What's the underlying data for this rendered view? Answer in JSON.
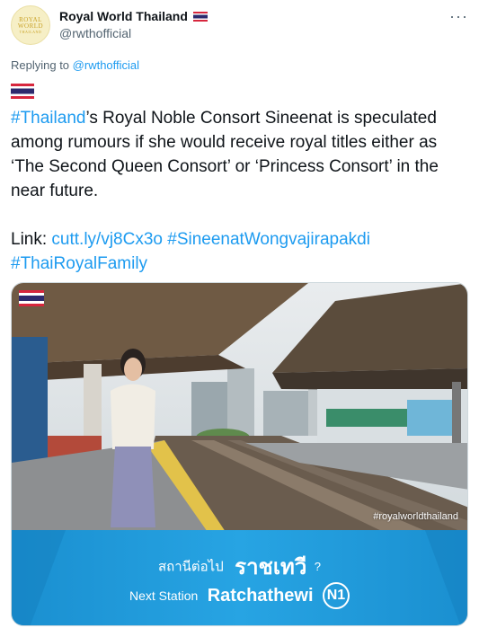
{
  "author": {
    "display_name": "Royal World Thailand",
    "handle": "@rwthofficial",
    "avatar_text": [
      "ROYAL",
      "WORLD",
      "THAILAND"
    ]
  },
  "more_icon": "···",
  "replying": {
    "prefix": "Replying to",
    "handle": "@rwthofficial"
  },
  "body": {
    "hashtag_thailand": "#Thailand",
    "sentence": "’s Royal Noble Consort Sineenat is speculated among rumours if she would receive royal titles either as ‘The Second Queen Consort’ or ‘Princess Consort’ in the near future.",
    "link_label": "Link:",
    "link": "cutt.ly/vj8Cx3o",
    "hashtag_sineenat": "#SineenatWongvajirapakdi",
    "hashtag_family": "#ThaiRoyalFamily"
  },
  "media": {
    "watermark": "#royalworldthailand",
    "next_station_thai": "สถานีต่อไป",
    "station_thai": "ราชเทวี",
    "question_mark": "?",
    "next_station_en": "Next Station",
    "station_en": "Ratchathewi",
    "station_code": "N1"
  },
  "colors": {
    "link": "#1d9bf0",
    "text": "#0f1419",
    "muted": "#536471",
    "banner_blue": "#1e9ad9"
  },
  "icons": [
    "thai-flag-icon",
    "more-icon"
  ]
}
